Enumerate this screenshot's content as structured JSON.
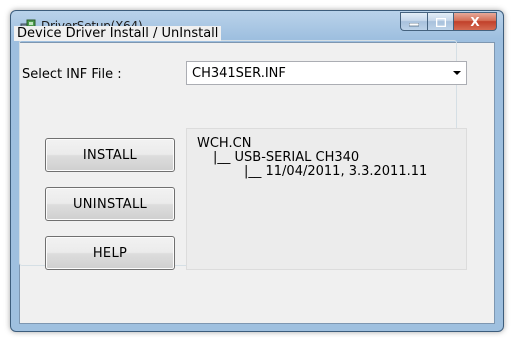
{
  "window": {
    "title": "DriverSetup(X64)",
    "icon": "driver-setup-icon"
  },
  "caption": {
    "minimize_icon": "minimize-icon",
    "maximize_icon": "maximize-icon",
    "close_label": "X"
  },
  "group": {
    "title": "Device Driver Install / UnInstall"
  },
  "inf": {
    "label": "Select INF File :",
    "value": "CH341SER.INF"
  },
  "buttons": {
    "install": "INSTALL",
    "uninstall": "UNINSTALL",
    "help": "HELP"
  },
  "info": {
    "lines": [
      "WCH.CN",
      "|__ USB-SERIAL CH340",
      "|__ 11/04/2011, 3.3.2011.11"
    ]
  },
  "colors": {
    "titlebar": "#a9c6e4",
    "close": "#c1402a",
    "client_bg": "#f0f0f0",
    "info_bg": "#ececec"
  }
}
